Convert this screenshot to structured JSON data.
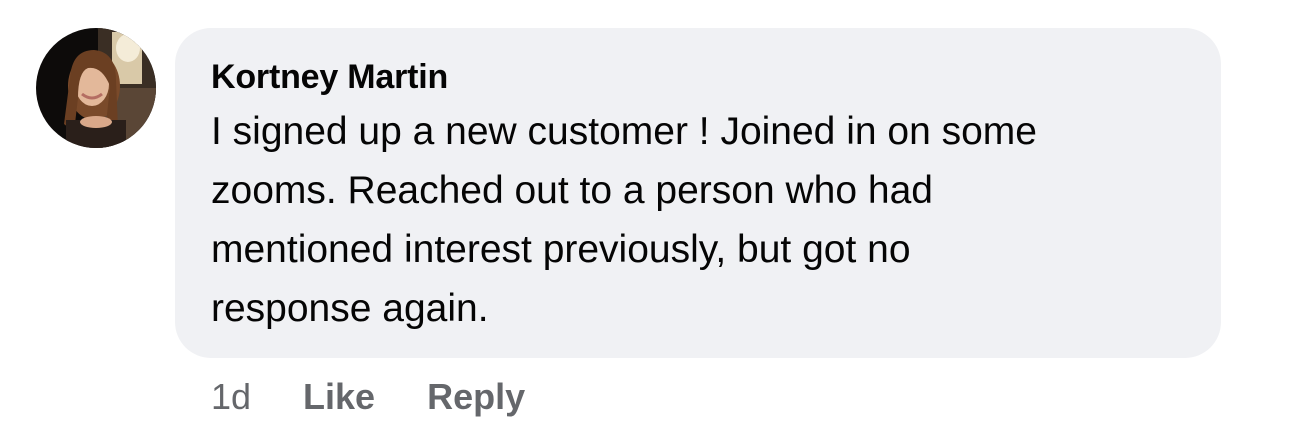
{
  "comment": {
    "author": "Kortney Martin",
    "avatar_icon": "profile-photo",
    "lines": [
      "I signed up a new customer ! Joined in on some",
      "zooms. Reached out to a person who had",
      "mentioned interest previously, but got no",
      "response again."
    ],
    "timestamp": "1d",
    "actions": {
      "like_label": "Like",
      "reply_label": "Reply"
    }
  },
  "colors": {
    "bubble_background": "#f0f1f4",
    "text_primary": "#050505",
    "text_secondary": "#65676b",
    "page_background": "#ffffff"
  }
}
